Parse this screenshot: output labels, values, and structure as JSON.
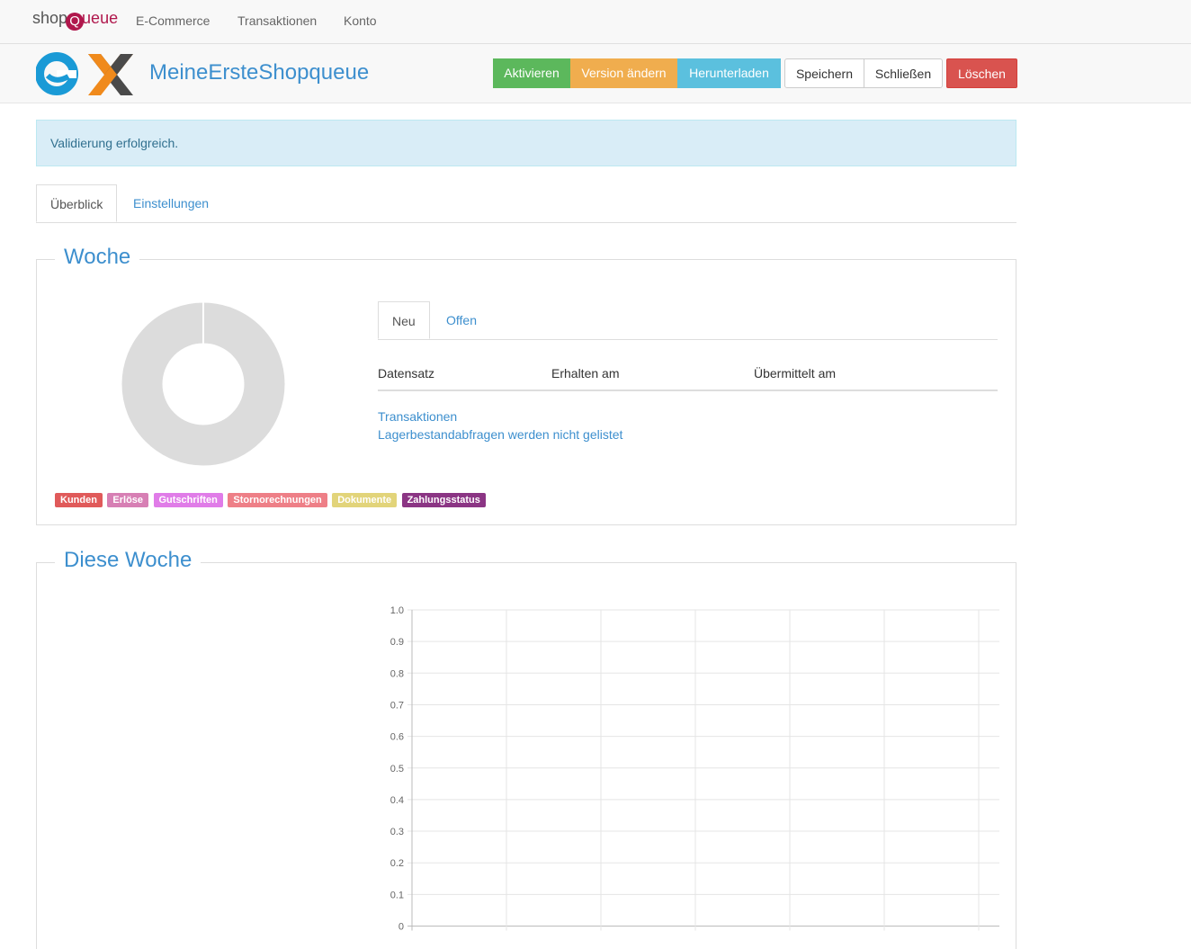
{
  "navbar": {
    "brand_shop": "shop",
    "brand_q": "Q",
    "brand_rest": "ueue",
    "links": [
      "E-Commerce",
      "Transaktionen",
      "Konto"
    ]
  },
  "header": {
    "title": "MeineErsteShopqueue",
    "buttons": {
      "activate": "Aktivieren",
      "change_version": "Version ändern",
      "download": "Herunterladen",
      "save": "Speichern",
      "close": "Schließen",
      "delete": "Löschen"
    }
  },
  "alert": {
    "text": "Validierung erfolgreich."
  },
  "tabs": {
    "overview": "Überblick",
    "settings": "Einstellungen"
  },
  "week": {
    "legend": "Woche",
    "badges": [
      {
        "label": "Kunden",
        "color": "#e05a5a"
      },
      {
        "label": "Erlöse",
        "color": "#d77fb4"
      },
      {
        "label": "Gutschriften",
        "color": "#e07ce8"
      },
      {
        "label": "Stornorechnungen",
        "color": "#ee7f87"
      },
      {
        "label": "Dokumente",
        "color": "#e2d47a"
      },
      {
        "label": "Zahlungsstatus",
        "color": "#8b3584"
      }
    ],
    "subtabs": {
      "new": "Neu",
      "open": "Offen"
    },
    "table_headers": [
      "Datensatz",
      "Erhalten am",
      "Übermittelt am"
    ],
    "link_transactions": "Transaktionen",
    "inventory_text": "Lagerbestandabfragen werden nicht gelistet"
  },
  "this_week": {
    "legend": "Diese Woche",
    "chart_data": {
      "type": "line",
      "ylim": [
        0,
        1.0
      ],
      "y_ticks": [
        "1.0",
        "0.9",
        "0.8",
        "0.7",
        "0.6",
        "0.5",
        "0.4",
        "0.3",
        "0.2",
        "0.1",
        "0"
      ],
      "grid": true,
      "series": []
    }
  }
}
